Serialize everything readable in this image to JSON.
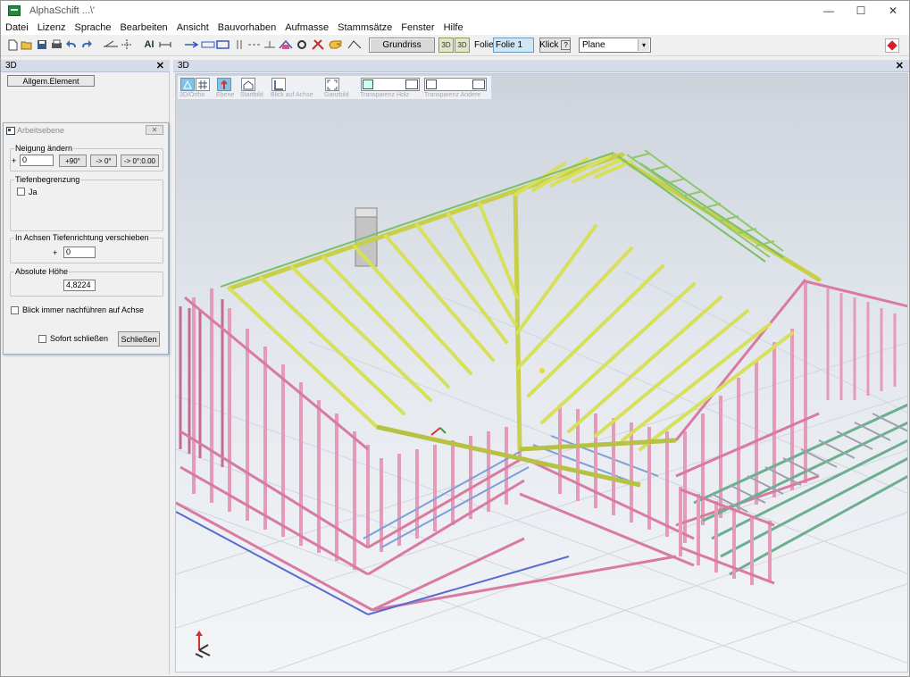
{
  "window": {
    "title": "AlphaSchift ...\\'",
    "minimize": "—",
    "maximize": "☐",
    "close": "✕"
  },
  "menu": [
    "Datei",
    "Lizenz",
    "Sprache",
    "Bearbeiten",
    "Ansicht",
    "Bauvorhaben",
    "Aufmasse",
    "Stammsätze",
    "Fenster",
    "Hilfe"
  ],
  "toolbar": {
    "grundriss": "Grundriss",
    "btn_3d_a": "3D",
    "btn_3d_b": "3D",
    "folie_label": "Folie:",
    "folie_value": "Folie 1",
    "klick": "Klick",
    "klick_icon": "?",
    "plane_value": "Plane",
    "plane_arrow": "▾",
    "text_ai": "AI"
  },
  "left_panel": {
    "title": "3D",
    "close": "✕",
    "allgem_button": "Allgem.Element"
  },
  "dialog": {
    "title": "Arbeitsebene",
    "close": "✕",
    "neigung": {
      "label": "Neigung ändern",
      "plus": "+",
      "value": "0",
      "btn_plus90": "+90°",
      "btn_to0": "-> 0°",
      "btn_to000": "-> 0°:0.00"
    },
    "tiefe": {
      "label": "Tiefenbegrenzung",
      "ja_label": "Ja",
      "ja_checked": false
    },
    "achsen": {
      "label": "In Achsen Tiefenrichtung verschieben",
      "plus": "+",
      "value": "0"
    },
    "hoehe": {
      "label": "Absolute Höhe",
      "value": "4,8224"
    },
    "blick_label": "Blick immer nachführen auf Achse",
    "blick_checked": false,
    "sofort_label": "Sofort schließen",
    "sofort_checked": false,
    "schliessen": "Schließen"
  },
  "view": {
    "title": "3D",
    "close": "✕",
    "tools": [
      {
        "label": "3D/Ortho"
      },
      {
        "label": "Ebene"
      },
      {
        "label": "Startbild"
      },
      {
        "label": "Blick auf Achse"
      },
      {
        "label": "Ganzbild"
      },
      {
        "label": "Transparenz Holz"
      },
      {
        "label": "Transparenz Andere"
      }
    ]
  },
  "colors": {
    "rafter_yellow": "#d7e05a",
    "wall_pink": "#e8a0b8",
    "floor_green": "#6bb08e",
    "background": "#e9edf1",
    "accent_red": "#d81f26"
  }
}
